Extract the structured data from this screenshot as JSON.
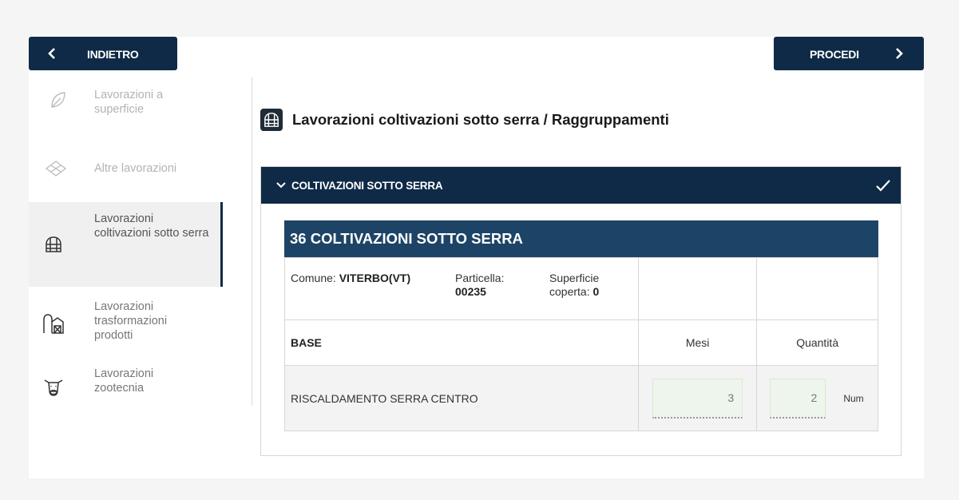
{
  "nav": {
    "back_label": "INDIETRO",
    "next_label": "PROCEDI"
  },
  "sidebar": {
    "items": [
      {
        "label": "Lavorazioni a superficie",
        "icon": "leaf-icon",
        "state": "disabled"
      },
      {
        "label": "Altre lavorazioni",
        "icon": "layers-icon",
        "state": "disabled"
      },
      {
        "label": "Lavorazioni coltivazioni sotto serra",
        "icon": "greenhouse-icon",
        "state": "active"
      },
      {
        "label": "Lavorazioni trasformazioni prodotti",
        "icon": "silo-icon",
        "state": "normal"
      },
      {
        "label": "Lavorazioni zootecnia",
        "icon": "cow-icon",
        "state": "normal"
      }
    ]
  },
  "main": {
    "title": "Lavorazioni coltivazioni sotto serra / Raggruppamenti",
    "accordion": {
      "label": "COLTIVAZIONI SOTTO SERRA",
      "section_title": "36 COLTIVAZIONI SOTTO SERRA",
      "info": {
        "comune_label": "Comune:",
        "comune_value": "VITERBO(VT)",
        "particella_label": "Particella:",
        "particella_value": "00235",
        "superficie_label": "Superficie coperta:",
        "superficie_value": "0"
      },
      "columns": {
        "base": "BASE",
        "mesi": "Mesi",
        "quantita": "Quantità"
      },
      "row": {
        "label": "RISCALDAMENTO SERRA CENTRO",
        "mesi": "3",
        "quantita": "2",
        "unit": "Num"
      }
    }
  },
  "colors": {
    "primary": "#0f2a47",
    "section": "#1d4466",
    "field_bg": "#eef5ec"
  }
}
